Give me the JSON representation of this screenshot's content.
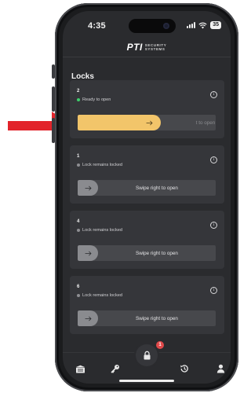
{
  "status_bar": {
    "time": "4:35",
    "battery": "35"
  },
  "brand": {
    "name": "PTI",
    "sub_line_1": "SECURITY",
    "sub_line_2": "SYSTEMS"
  },
  "page": {
    "title": "Locks"
  },
  "locks": [
    {
      "number": "2",
      "status": "Ready to open",
      "status_color": "#3ecf6c",
      "slider_label": "Swipe right to open",
      "slider_visible_label": "t to open",
      "swipe_progress": 0.6
    },
    {
      "number": "1",
      "status": "Lock remains locked",
      "status_color": "#8e8e92",
      "slider_label": "Swipe right to open"
    },
    {
      "number": "4",
      "status": "Lock remains locked",
      "status_color": "#8e8e92",
      "slider_label": "Swipe right to open"
    },
    {
      "number": "6",
      "status": "Lock remains locked",
      "status_color": "#8e8e92",
      "slider_label": "Swipe right to open"
    }
  ],
  "tab_bar": {
    "items": [
      "locks-list-icon",
      "key-icon",
      "lock-icon",
      "history-icon",
      "user-icon"
    ],
    "badge_count": "1"
  },
  "colors": {
    "accent": "#f2c56a",
    "annotation": "#e2242b",
    "badge": "#e0494a"
  }
}
